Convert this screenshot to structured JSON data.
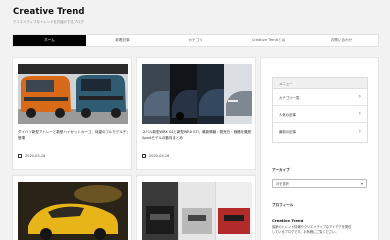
{
  "site": {
    "title": "Creative Trend",
    "tagline": "クリエイティブなトレンドをお届けするブログ"
  },
  "nav": {
    "items": [
      {
        "label": "ホーム"
      },
      {
        "label": "新着記事"
      },
      {
        "label": "カテゴリ"
      },
      {
        "label": "Creative Trendとは"
      },
      {
        "label": "お問い合わせ"
      }
    ]
  },
  "posts": [
    {
      "title_line1": "ダイハツ新型アトレーと新型ハイゼットカーゴ、待望のフルモデルチェンジで",
      "title_line2": "登場",
      "date": "2020-03-16",
      "image": "atrai-hijet-vans-photo"
    },
    {
      "title_line1": "スバル新型WRX S4と新型WRX STI、最新情報・発売日・価格を徹底予想WRX S4/STI",
      "title_line2": "Sportモデルの動向まとめ",
      "date": "2020-03-16",
      "image": "subaru-wrx-photo"
    },
    {
      "image": "lexus-yellow-coupe-photo"
    },
    {
      "image": "suv-grille-collage-photo"
    }
  ],
  "sidebar": {
    "menu_header": "メニュー",
    "links": [
      {
        "label": "カテゴリ一覧"
      },
      {
        "label": "人気の記事"
      },
      {
        "label": "最新の記事"
      }
    ],
    "archive_label": "アーカイブ",
    "archive_select": "月を選択",
    "about_label": "プロフィール",
    "about_name": "Creative Trend",
    "about_text_line1": "最新のトレンド情報やクリエイティブなアイデアを発信",
    "about_text_line2": "しているブログです。お気軽にご覧ください。"
  },
  "colors": {
    "nav_active_bg": "#000000",
    "page_bg": "#f2f2f2"
  }
}
